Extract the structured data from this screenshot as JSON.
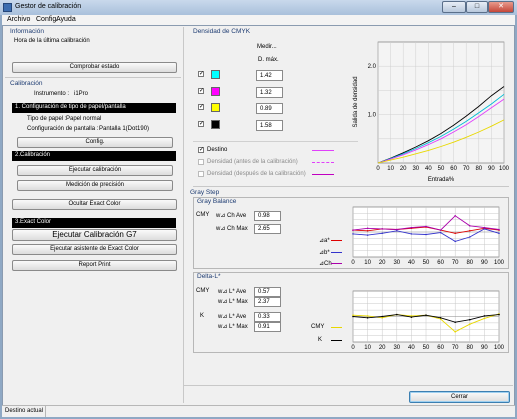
{
  "window": {
    "title": "Gestor de calibración",
    "minimize": "‒",
    "maximize": "□",
    "close": "✕"
  },
  "menu": [
    "Archivo",
    "Config.",
    "Ayuda"
  ],
  "left": {
    "info_header": "Información",
    "last_calibration_label": "Hora de la última calibración",
    "check_state_button": "Comprobar estado",
    "calibration_header": "Calibración",
    "instrument_label": "Instrumento :",
    "instrument_value": "i1Pro",
    "step1_title": "1. Configuración de tipo de papel/pantalla",
    "paper_type_label": "Tipo de papel :",
    "paper_type_value": "Papel normal",
    "screen_config_label": "Configuración de pantalla :",
    "screen_config_value": "Pantalla 1(Dot190)",
    "config_button": "Config.",
    "step2_title": "2.Calibración",
    "run_calibration_button": "Ejecutar calibración",
    "precision_button": "Medición de precisión",
    "hide_exact_color_button": "Ocultar Exact Color",
    "step3_title": "3.Exact Color",
    "g7_button": "Ejecutar Calibración G7",
    "exact_color_wizard_button": "Ejecutar asistente de Exact Color",
    "report_print_button": "Report Print"
  },
  "density": {
    "header": "Densidad de CMYK",
    "measure_label": "Medir...",
    "dmax_label": "D. máx.",
    "rows": [
      {
        "channel": "C",
        "color": "#00ffff",
        "checked": "✓",
        "value": "1.42"
      },
      {
        "channel": "M",
        "color": "#ff00ff",
        "checked": "✓",
        "value": "1.32"
      },
      {
        "channel": "Y",
        "color": "#ffff00",
        "checked": "✓",
        "value": "0.89"
      },
      {
        "channel": "K",
        "color": "#000000",
        "checked": "✓",
        "value": "1.58"
      }
    ],
    "legend": [
      {
        "label": "Destino",
        "checked": "✓",
        "enabled": true,
        "style": "solid"
      },
      {
        "label": "Densidad (antes de la calibración)",
        "checked": "",
        "enabled": false,
        "style": "dashed"
      },
      {
        "label": "Densidad (después de la calibración)",
        "checked": "",
        "enabled": false,
        "style": "solid"
      }
    ],
    "chart": {
      "y_axis_label": "Salida de densidad",
      "x_axis_label": "Entrada%",
      "y_ticks": [
        "2.0",
        "1.0"
      ],
      "x_ticks": [
        "0",
        "10",
        "20",
        "30",
        "40",
        "50",
        "60",
        "70",
        "80",
        "90",
        "100"
      ]
    }
  },
  "gray": {
    "header": "Gray Step",
    "balance_header": "Gray Balance",
    "cmy_label": "CMY",
    "ch_ave_label": "w⊿ Ch Ave",
    "ch_ave_value": "0.98",
    "ch_max_label": "w⊿ Ch Max",
    "ch_max_value": "2.65",
    "balance_legend": [
      "⊿a*",
      "⊿b*",
      "⊿Ch"
    ],
    "balance_colors": [
      "#dd0000",
      "#3333cc",
      "#aa00aa"
    ],
    "delta_header": "Delta-L*",
    "cmy_l_ave_label": "w⊿ L* Ave",
    "cmy_l_ave_value": "0.57",
    "cmy_l_max_label": "w⊿ L* Max",
    "cmy_l_max_value": "2.37",
    "k_label": "K",
    "k_l_ave_label": "w⊿ L* Ave",
    "k_l_ave_value": "0.33",
    "k_l_max_label": "w⊿ L* Max",
    "k_l_max_value": "0.91",
    "delta_legend": [
      "CMY",
      "K"
    ],
    "delta_colors": [
      "#e8d800",
      "#000000"
    ],
    "x_ticks": [
      "0",
      "10",
      "20",
      "30",
      "40",
      "50",
      "60",
      "70",
      "80",
      "90",
      "100"
    ]
  },
  "chart_data": [
    {
      "type": "line",
      "title": "Densidad de CMYK",
      "xlabel": "Entrada%",
      "ylabel": "Salida de densidad",
      "xlim": [
        0,
        100
      ],
      "ylim": [
        0,
        2.5
      ],
      "x": [
        0,
        10,
        20,
        30,
        40,
        50,
        60,
        70,
        80,
        90,
        100
      ],
      "series": [
        {
          "color": "#000000",
          "values": [
            0,
            0.1,
            0.21,
            0.33,
            0.46,
            0.61,
            0.78,
            0.97,
            1.17,
            1.39,
            1.58
          ]
        },
        {
          "color": "#00bcd4",
          "values": [
            0,
            0.09,
            0.19,
            0.3,
            0.42,
            0.55,
            0.7,
            0.86,
            1.04,
            1.22,
            1.42
          ]
        },
        {
          "color": "#e040fb",
          "values": [
            0,
            0.08,
            0.17,
            0.27,
            0.38,
            0.5,
            0.64,
            0.79,
            0.96,
            1.14,
            1.32
          ]
        },
        {
          "color": "#e8d800",
          "values": [
            0,
            0.06,
            0.12,
            0.19,
            0.26,
            0.34,
            0.43,
            0.53,
            0.64,
            0.76,
            0.89
          ]
        }
      ],
      "grid": true
    },
    {
      "type": "line",
      "title": "Gray Balance",
      "xlim": [
        0,
        100
      ],
      "ylim": [
        -4,
        4
      ],
      "x": [
        0,
        10,
        20,
        30,
        40,
        50,
        60,
        70,
        80,
        90,
        100
      ],
      "series": [
        {
          "name": "⊿a*",
          "color": "#dd0000",
          "values": [
            0.3,
            0.2,
            0.5,
            0.4,
            0.6,
            0.8,
            0.3,
            -0.2,
            0.2,
            0.6,
            0.3
          ]
        },
        {
          "name": "⊿b*",
          "color": "#3333cc",
          "values": [
            -0.3,
            -0.5,
            -0.2,
            0.2,
            -0.3,
            -0.4,
            -0.1,
            -1.5,
            -0.8,
            0.5,
            -0.2
          ]
        },
        {
          "name": "⊿Ch",
          "color": "#aa00aa",
          "values": [
            0.3,
            0.6,
            0.5,
            0.4,
            0.7,
            0.9,
            0.3,
            2.6,
            1.0,
            0.7,
            0.4
          ]
        }
      ],
      "grid": true
    },
    {
      "type": "line",
      "title": "Delta-L*",
      "xlim": [
        0,
        100
      ],
      "ylim": [
        -4,
        4
      ],
      "x": [
        0,
        10,
        20,
        30,
        40,
        50,
        60,
        70,
        80,
        90,
        100
      ],
      "series": [
        {
          "name": "CMY",
          "color": "#e8d800",
          "values": [
            0.2,
            0.1,
            -0.2,
            0.3,
            0.1,
            0.2,
            -0.4,
            -2.4,
            -1.2,
            -0.3,
            0.4
          ]
        },
        {
          "name": "K",
          "color": "#000000",
          "values": [
            0.0,
            -0.2,
            0.0,
            0.3,
            -0.1,
            0.2,
            -0.2,
            -0.9,
            -0.5,
            0.1,
            0.3
          ]
        }
      ],
      "grid": true
    }
  ],
  "footer": {
    "close_button": "Cerrar",
    "status": "Destino actual"
  }
}
